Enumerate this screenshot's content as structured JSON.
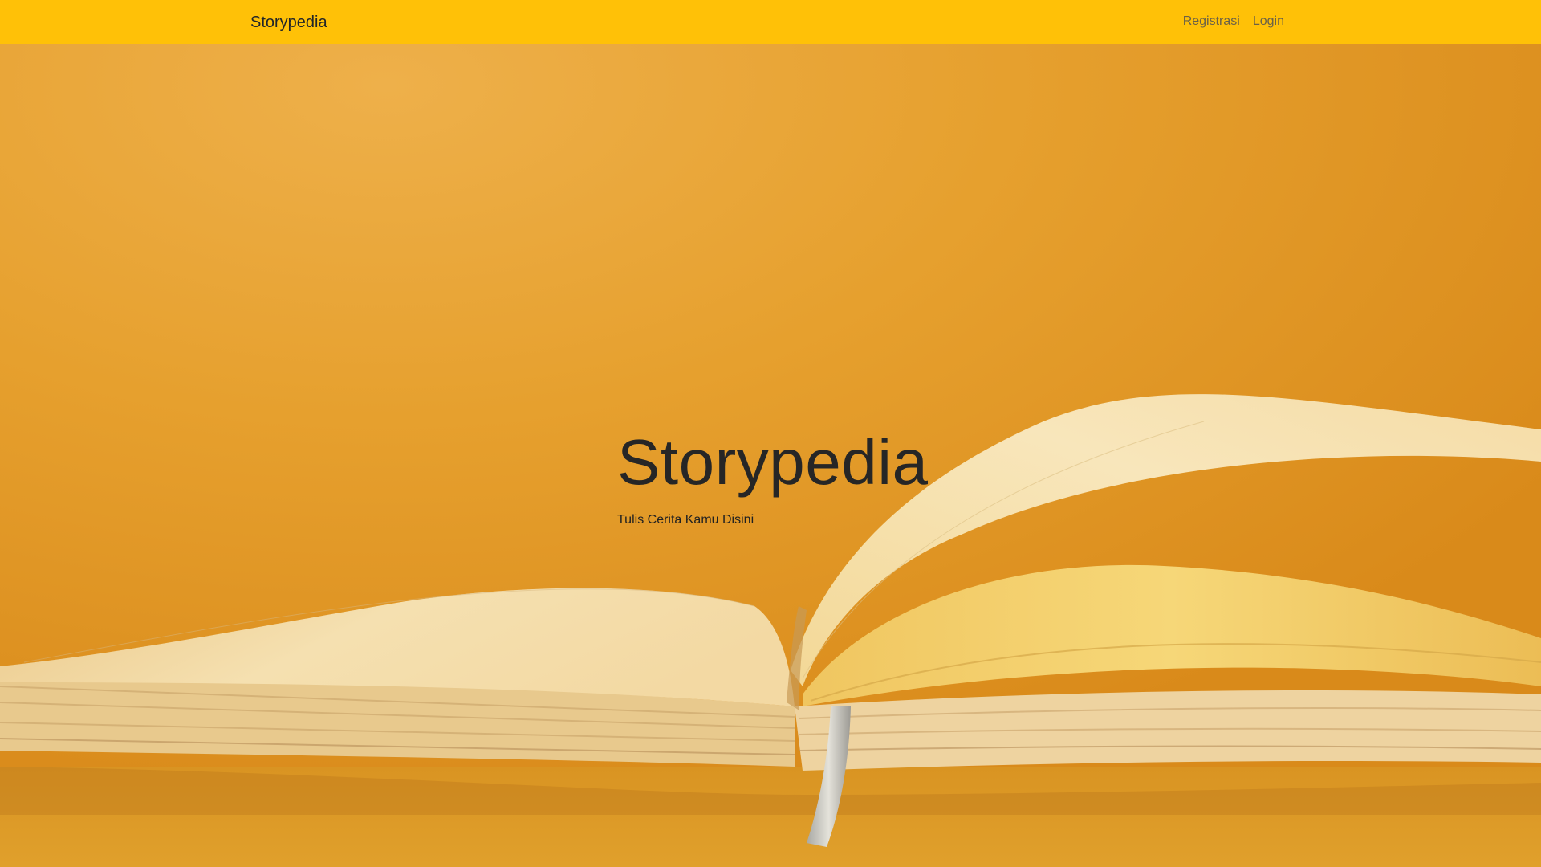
{
  "navbar": {
    "brand": "Storypedia",
    "links": [
      {
        "label": "Registrasi"
      },
      {
        "label": "Login"
      }
    ],
    "background_color": "#ffc107"
  },
  "hero": {
    "title": "Storypedia",
    "subtitle": "Tulis Cerita Kamu Disini",
    "background_image": "open-book-on-orange-background"
  },
  "colors": {
    "accent": "#ffc107",
    "backdrop": "#e59a22",
    "paper": "#f6dfa4"
  }
}
